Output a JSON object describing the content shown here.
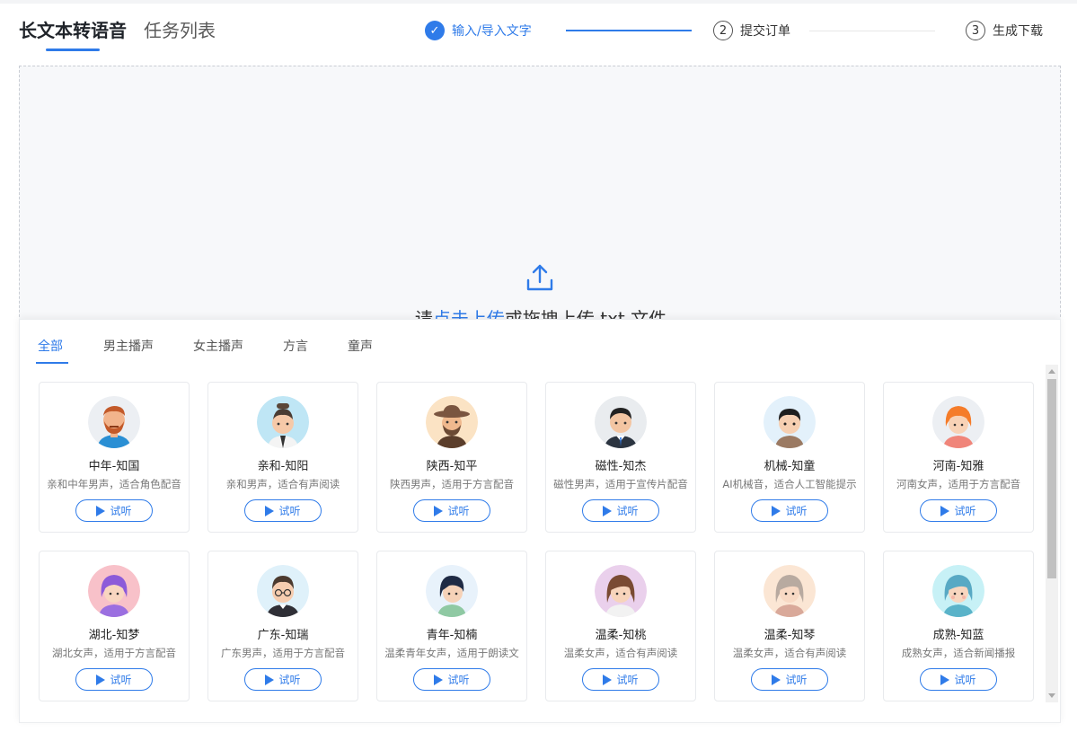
{
  "header": {
    "tabs": [
      {
        "label": "长文本转语音"
      },
      {
        "label": "任务列表"
      }
    ],
    "steps": [
      {
        "index": "✓",
        "label": "输入/导入文字"
      },
      {
        "index": "2",
        "label": "提交订单"
      },
      {
        "index": "3",
        "label": "生成下载"
      }
    ]
  },
  "upload": {
    "prefix": "请",
    "link": "点击上传",
    "suffix": "或拖拽上传 txt 文件"
  },
  "categories": [
    "全部",
    "男主播声",
    "女主播声",
    "方言",
    "童声"
  ],
  "voices": [
    {
      "name": "中年-知国",
      "desc": "亲和中年男声，适合角色配音",
      "play": "试听"
    },
    {
      "name": "亲和-知阳",
      "desc": "亲和男声，适合有声阅读",
      "play": "试听"
    },
    {
      "name": "陕西-知平",
      "desc": "陕西男声，适用于方言配音",
      "play": "试听"
    },
    {
      "name": "磁性-知杰",
      "desc": "磁性男声，适用于宣传片配音",
      "play": "试听"
    },
    {
      "name": "机械-知童",
      "desc": "AI机械音，适合人工智能提示",
      "play": "试听"
    },
    {
      "name": "河南-知雅",
      "desc": "河南女声，适用于方言配音",
      "play": "试听"
    },
    {
      "name": "湖北-知梦",
      "desc": "湖北女声，适用于方言配音",
      "play": "试听"
    },
    {
      "name": "广东-知瑞",
      "desc": "广东男声，适用于方言配音",
      "play": "试听"
    },
    {
      "name": "青年-知楠",
      "desc": "温柔青年女声，适用于朗读文",
      "play": "试听"
    },
    {
      "name": "温柔-知桃",
      "desc": "温柔女声，适合有声阅读",
      "play": "试听"
    },
    {
      "name": "温柔-知琴",
      "desc": "温柔女声，适合有声阅读",
      "play": "试听"
    },
    {
      "name": "成熟-知蓝",
      "desc": "成熟女声，适合新闻播报",
      "play": "试听"
    }
  ],
  "colors": {
    "accent": "#2f7be9"
  }
}
